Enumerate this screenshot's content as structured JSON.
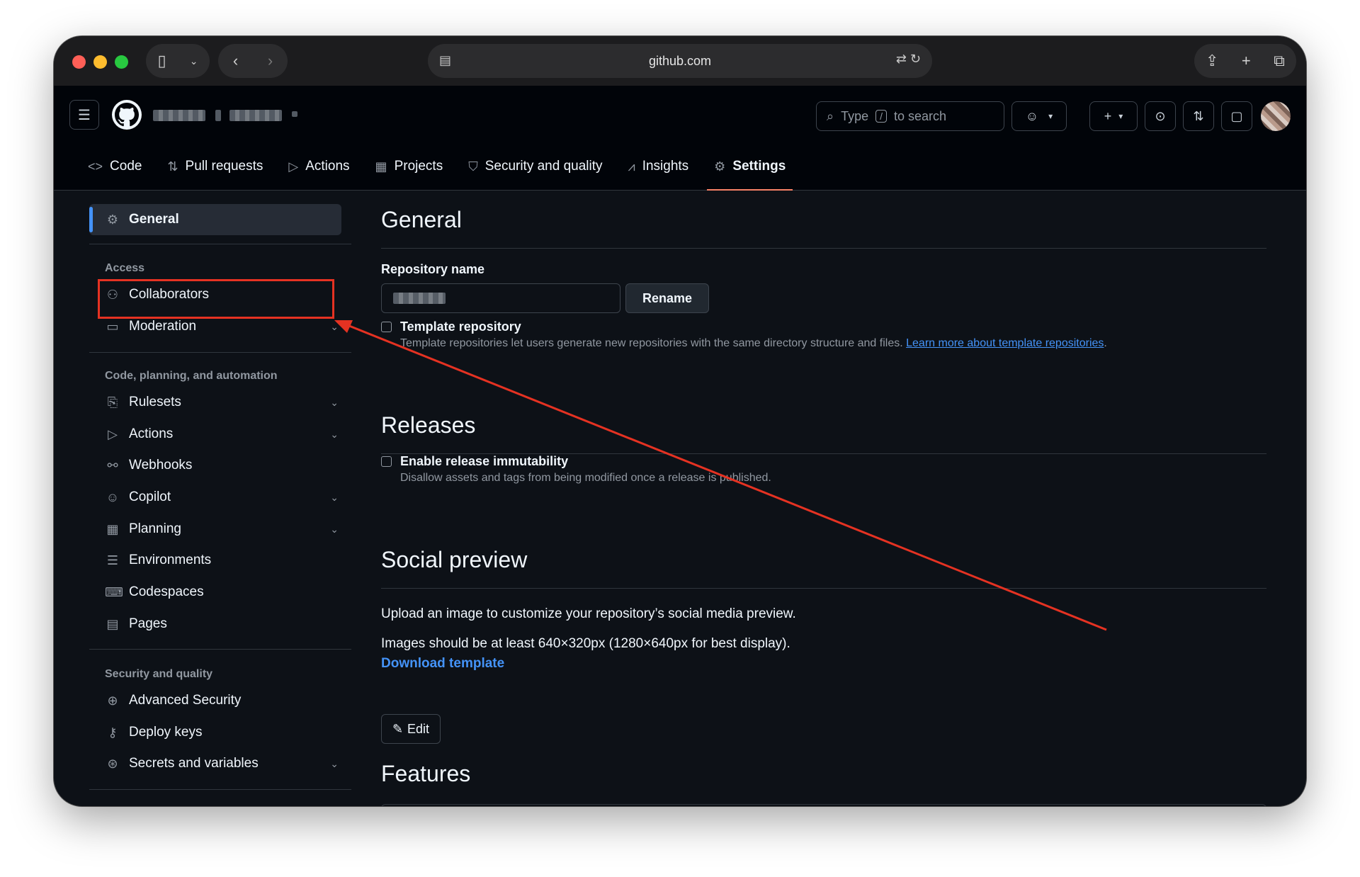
{
  "browser": {
    "url": "github.com",
    "icons": [
      "sidebar-icon",
      "chevron-down-icon",
      "back-icon",
      "forward-icon",
      "page-icon",
      "translate-icon",
      "reload-icon",
      "share-icon",
      "new-tab-icon",
      "tabs-icon"
    ]
  },
  "header": {
    "search_type": "Type",
    "search_key": "/",
    "search_suffix": "to search"
  },
  "repo_tabs": [
    {
      "label": "Code",
      "icon": "code-icon"
    },
    {
      "label": "Pull requests",
      "icon": "pull-request-icon"
    },
    {
      "label": "Actions",
      "icon": "play-icon"
    },
    {
      "label": "Projects",
      "icon": "table-icon"
    },
    {
      "label": "Security and quality",
      "icon": "shield-icon"
    },
    {
      "label": "Insights",
      "icon": "graph-icon"
    },
    {
      "label": "Settings",
      "icon": "gear-icon",
      "active": true
    }
  ],
  "sidebar": {
    "general": "General",
    "access_heading": "Access",
    "collaborators": "Collaborators",
    "moderation": "Moderation",
    "code_heading": "Code, planning, and automation",
    "rulesets": "Rulesets",
    "actions": "Actions",
    "webhooks": "Webhooks",
    "copilot": "Copilot",
    "planning": "Planning",
    "environments": "Environments",
    "codespaces": "Codespaces",
    "pages": "Pages",
    "security_heading": "Security and quality",
    "advanced_security": "Advanced Security",
    "deploy_keys": "Deploy keys",
    "secrets": "Secrets and variables"
  },
  "main": {
    "general_title": "General",
    "repo_name_label": "Repository name",
    "rename_button": "Rename",
    "template_label": "Template repository",
    "template_desc": "Template repositories let users generate new repositories with the same directory structure and files.",
    "template_link": "Learn more about template repositories",
    "releases_title": "Releases",
    "immutability_label": "Enable release immutability",
    "immutability_desc": "Disallow assets and tags from being modified once a release is published.",
    "social_title": "Social preview",
    "social_desc1": "Upload an image to customize your repository’s social media preview.",
    "social_desc2": "Images should be at least 640×320px (1280×640px for best display).",
    "download_template": "Download template",
    "edit_button": "Edit",
    "features_title": "Features"
  },
  "annotation": {
    "color": "#e53222"
  },
  "colors": {
    "background": "#0d1117",
    "header": "#010409",
    "accent": "#4493f8",
    "tab_underline": "#f78166"
  }
}
